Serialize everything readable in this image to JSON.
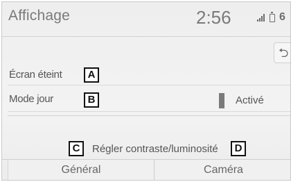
{
  "header": {
    "title": "Affichage",
    "clock": "2:56"
  },
  "status": {
    "icons": [
      "signal-icon",
      "battery-icon",
      "extra-icon"
    ],
    "extra_glyph": "6"
  },
  "back_button": {
    "icon": "back-arrow-icon",
    "glyph": "⮌"
  },
  "settings": [
    {
      "label": "Écran éteint",
      "marker": "A"
    },
    {
      "label": "Mode jour",
      "marker": "B",
      "status_text": "Activé"
    }
  ],
  "contrast": {
    "label": "Régler contraste/luminosité",
    "marker_left": "C",
    "marker_right": "D"
  },
  "tabs": [
    {
      "label": "Général"
    },
    {
      "label": "Caméra"
    }
  ],
  "colors": {
    "text": "#555555",
    "header_text": "#7a7a7a",
    "marker_border": "#111111",
    "indicator": "#7a7a7a"
  }
}
